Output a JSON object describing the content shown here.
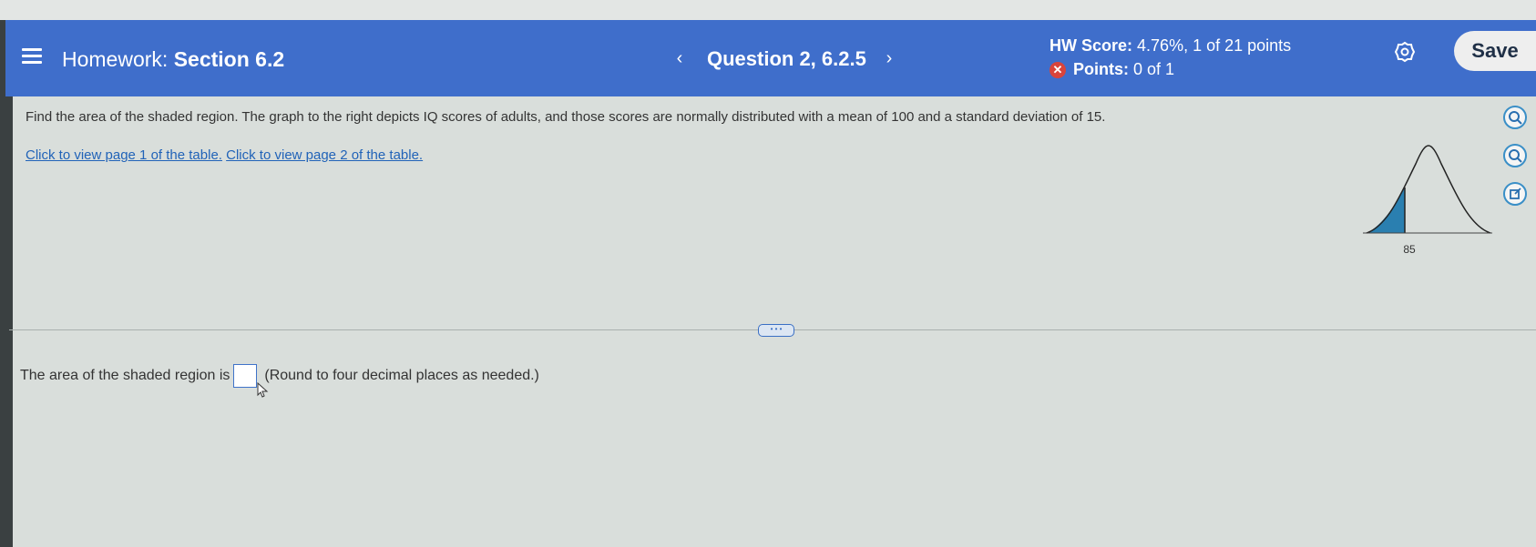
{
  "header": {
    "title_prefix": "Homework:",
    "title_section": "Section 6.2",
    "question_label": "Question 2, 6.2.5",
    "prev_symbol": "‹",
    "next_symbol": "›",
    "score_label": "HW Score:",
    "score_value": "4.76%, 1 of 21 points",
    "points_label": "Points:",
    "points_value": "0 of 1",
    "save_label": "Save",
    "icons": [
      "menu-icon",
      "chevron-left-icon",
      "chevron-right-icon",
      "incorrect-icon",
      "gear-icon"
    ]
  },
  "problem": {
    "text": "Find the area of the shaded region. The graph to the right depicts IQ scores of adults, and those scores are normally distributed with a mean of 100 and a standard deviation of 15.",
    "link1": "Click to view page 1 of the table.",
    "link2": "Click to view page 2 of the table."
  },
  "graph": {
    "tick_label": "85",
    "shade_color": "#2a7fb0"
  },
  "answer": {
    "prefix": "The area of the shaded region is",
    "value": "",
    "suffix": "(Round to four decimal places as needed.)"
  },
  "side_tools": [
    "zoom-in-icon",
    "zoom-out-icon",
    "popout-icon"
  ],
  "colors": {
    "header_bg": "#3f6ecb",
    "link": "#2163b8",
    "incorrect": "#d9443c"
  }
}
